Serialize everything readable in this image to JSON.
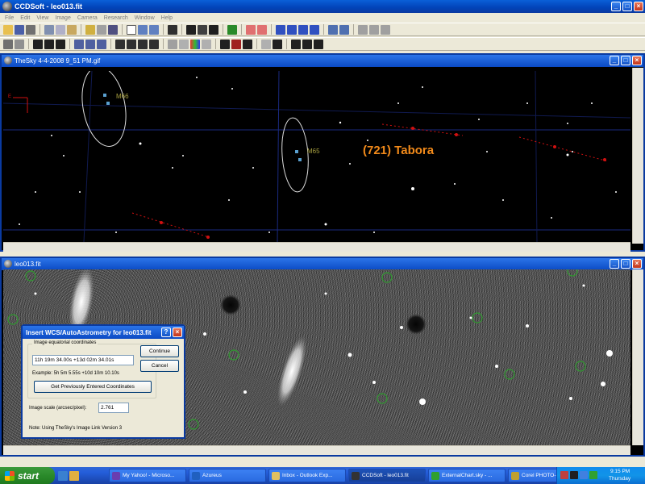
{
  "app": {
    "title": "CCDSoft - leo013.fit",
    "menus": [
      "File",
      "Edit",
      "View",
      "Image",
      "Camera",
      "Research",
      "Window",
      "Help"
    ]
  },
  "sky_window": {
    "title": "TheSky 4-4-2008 9_51 PM.gif",
    "labels": {
      "object1": "M66",
      "object2": "M65",
      "asteroid": "(721) Tabora"
    },
    "colors": {
      "asteroid_label": "#f28a1a",
      "object_label": "#a8a040",
      "tracks": "#d01010"
    }
  },
  "image_window": {
    "title": "leo013.fit"
  },
  "dialog": {
    "title": "Insert WCS/AutoAstrometry for leo013.fit",
    "group_label": "Image equatorial coordinates",
    "coordinates_value": "11h 19m 34.00s +13d 02m 34.01s",
    "example_text": "Example: 5h 5m 5.55s  +10d 10m 10.10s",
    "prev_coords_button": "Get Previously Entered Coordinates",
    "continue_button": "Continue",
    "cancel_button": "Cancel",
    "scale_label": "Image scale (arcsec/pixel):",
    "scale_value": "2.761",
    "note": "Note: Using TheSky's Image Link Version 3"
  },
  "taskbar": {
    "start_label": "start",
    "tasks": [
      "My Yahoo! - Microso...",
      "Azureus",
      "Inbox - Outlook Exp...",
      "CCDSoft - leo013.fit",
      "ExternalChart.sky - ...",
      "Corel PHOTO-PAINT 8"
    ],
    "clock": "9:15 PM",
    "day": "Thursday"
  }
}
